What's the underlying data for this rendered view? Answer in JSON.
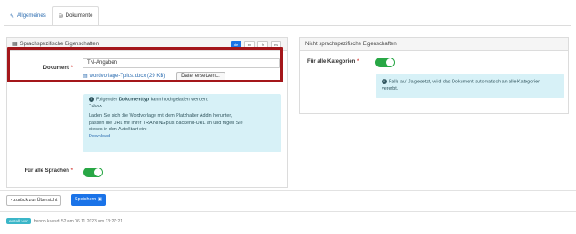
{
  "tabs": [
    {
      "label": "Allgemeines",
      "icon": "pencil-icon"
    },
    {
      "label": "Dokumente",
      "icon": "database-icon"
    }
  ],
  "left_panel": {
    "title": "Sprachspezifische Eigenschaften",
    "languages": [
      "de",
      "en",
      "fr",
      "es"
    ],
    "dokument_label": "Dokument",
    "dokument_value": "TN-Angaben",
    "file_name": "wordvorlage-Tplus.docx (29 KB)",
    "replace_button": "Datei ersetzen...",
    "info_line1_pre": "Folgender ",
    "info_line1_bold": "Dokumenttyp",
    "info_line1_post": " kann hochgeladen werden:",
    "info_line2": "*.docx",
    "info_line3": "Laden Sie sich die Wordvorlage mit dem Platzhalter Addin herunter,",
    "info_line4": "passen die URL mit Ihrer TRAININGplus Backend-URL an und fügen Sie",
    "info_line5": "dieses in den AutoStart ein:",
    "info_download": "Download",
    "all_languages_label": "Für alle Sprachen",
    "all_languages_enabled": true
  },
  "right_panel": {
    "title": "Nicht sprachspezifische Eigenschaften",
    "categories_label": "Für alle Kategorien",
    "categories_enabled": true,
    "info_line1": "Falls auf Ja gesetzt, wird das Dokument automatisch an alle Kategorien",
    "info_line2": "vererbt."
  },
  "buttons": {
    "back": "zurück zur Übersicht",
    "save": "Speichern"
  },
  "footer": {
    "badge": "erstellt von",
    "text": "benno.kaesdi.52 am 06.11.2023 um 13:27:21"
  },
  "colors": {
    "primary": "#1a73e8",
    "toggle_on": "#28a745",
    "highlight": "#a4161a",
    "info_bg": "#d7f1f7"
  }
}
